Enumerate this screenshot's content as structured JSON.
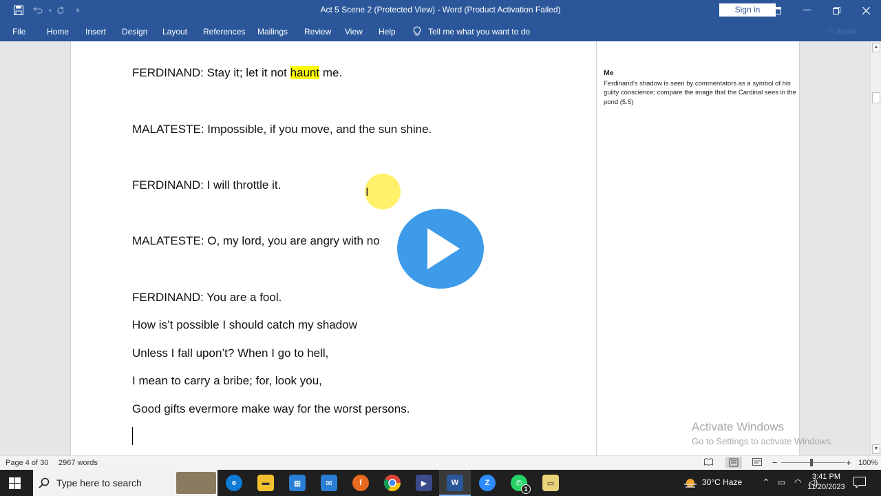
{
  "window": {
    "title": "Act 5 Scene 2 (Protected View)  -  Word (Product Activation Failed)",
    "sign_in": "Sign in"
  },
  "quick_access": [
    "save-icon",
    "undo-icon",
    "redo-icon",
    "customize-icon"
  ],
  "ribbon": {
    "tabs": [
      "File",
      "Home",
      "Insert",
      "Design",
      "Layout",
      "References",
      "Mailings",
      "Review",
      "View",
      "Help"
    ],
    "tell_me": "Tell me what you want to do",
    "share": "Share"
  },
  "document": {
    "lines": [
      {
        "before": "FERDINAND: Stay it; let it not ",
        "highlight": "haunt",
        "after": " me."
      },
      {
        "text": "MALATESTE: Impossible, if you move, and the sun shine."
      },
      {
        "text": "FERDINAND: I will throttle it."
      },
      {
        "text": "MALATESTE: O, my lord, you are angry with no"
      },
      {
        "text": "FERDINAND: You are a fool."
      },
      {
        "text": "How is’t possible I should catch my shadow"
      },
      {
        "text": "Unless I fall upon’t? When I go to hell,"
      },
      {
        "text": "I mean to carry a bribe; for, look you,"
      },
      {
        "text": "Good gifts evermore make way for the worst persons."
      }
    ]
  },
  "comment": {
    "author": "Me",
    "text": "Ferdinand’s shadow is seen by commentators as a symbol of his guilty conscience; compare the image that the Cardinal sees in the pond (5.5)"
  },
  "watermark": {
    "line1": "Activate Windows",
    "line2": "Go to Settings to activate Windows."
  },
  "status": {
    "page": "Page 4 of 30",
    "words": "2967 words",
    "zoom": "100%",
    "zoom_minus": "−",
    "zoom_plus": "+"
  },
  "taskbar": {
    "search_placeholder": "Type here to search",
    "weather": "30°C  Haze",
    "time": "3:41 PM",
    "date": "11/20/2023",
    "apps": [
      "edge-icon",
      "file-explorer-icon",
      "store-icon",
      "mail-icon",
      "firefox-icon",
      "chrome-icon",
      "media-icon",
      "word-icon",
      "zoom-icon",
      "whatsapp-icon",
      "folder-icon"
    ],
    "whatsapp_badge": "1"
  },
  "colors": {
    "word_blue": "#2b579a",
    "highlight": "#ffff00",
    "play_blue": "#3d9be9"
  }
}
